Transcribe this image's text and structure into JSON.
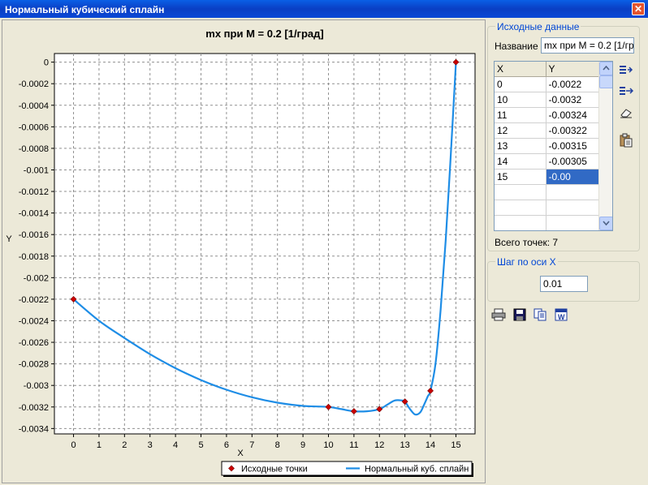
{
  "window": {
    "title": "Нормальный кубический сплайн",
    "close_glyph": "✕"
  },
  "chart_data": {
    "type": "line",
    "title": "mx при M = 0.2  [1/град]",
    "xlabel": "X",
    "ylabel": "Y",
    "xlim": [
      -0.75,
      15.75
    ],
    "ylim": [
      -0.00345,
      8e-05
    ],
    "x_ticks": [
      0,
      1,
      2,
      3,
      4,
      5,
      6,
      7,
      8,
      9,
      10,
      11,
      12,
      13,
      14,
      15
    ],
    "y_ticks": [
      0,
      -0.0002,
      -0.0004,
      -0.0006,
      -0.0008,
      -0.001,
      -0.0012,
      -0.0014,
      -0.0016,
      -0.0018,
      -0.002,
      -0.0022,
      -0.0024,
      -0.0026,
      -0.0028,
      -0.003,
      -0.0032,
      -0.0034
    ],
    "grid": true,
    "legend_position": "bottom",
    "series": [
      {
        "name": "Исходные точки",
        "kind": "markers",
        "color": "#cc0000",
        "x": [
          0,
          10,
          11,
          12,
          13,
          14,
          15
        ],
        "y": [
          -0.0022,
          -0.0032,
          -0.00324,
          -0.00322,
          -0.00315,
          -0.00305,
          0.0
        ]
      },
      {
        "name": "Нормальный куб. сплайн",
        "kind": "line",
        "color": "#1e8de6",
        "x": [
          0,
          1,
          2,
          3,
          4,
          5,
          6,
          7,
          8,
          9,
          10,
          10.5,
          11,
          11.5,
          12,
          12.3,
          12.6,
          12.9,
          13.0,
          13.2,
          13.4,
          13.6,
          13.75,
          13.9,
          14.0,
          14.2,
          14.4,
          14.6,
          14.8,
          15.0
        ],
        "y": [
          -0.0022,
          -0.0024,
          -0.00256,
          -0.00271,
          -0.00284,
          -0.00295,
          -0.00304,
          -0.00311,
          -0.00316,
          -0.00319,
          -0.0032,
          -0.00322,
          -0.00324,
          -0.00324,
          -0.00322,
          -0.00318,
          -0.00314,
          -0.00314,
          -0.00315,
          -0.00322,
          -0.00327,
          -0.00325,
          -0.00318,
          -0.0031,
          -0.00305,
          -0.0028,
          -0.0023,
          -0.00165,
          -0.00085,
          0.0
        ]
      }
    ]
  },
  "side": {
    "source_group_title": "Исходные данные",
    "name_label": "Название",
    "name_value": "mx при M = 0.2  [1/гр",
    "columns": [
      "X",
      "Y"
    ],
    "rows": [
      {
        "x": "0",
        "y": "-0.0022"
      },
      {
        "x": "10",
        "y": "-0.0032"
      },
      {
        "x": "11",
        "y": "-0.00324"
      },
      {
        "x": "12",
        "y": "-0.00322"
      },
      {
        "x": "13",
        "y": "-0.00315"
      },
      {
        "x": "14",
        "y": "-0.00305"
      },
      {
        "x": "15",
        "y": "-0.00"
      }
    ],
    "total_points_label": "Всего точек: 7",
    "step_group_title": "Шаг по оси X",
    "step_value": "0.01",
    "icons": {
      "insert_row": "insert-row-icon",
      "append_row": "append-row-icon",
      "clear": "eraser-icon",
      "paste": "paste-icon",
      "print": "print-icon",
      "save": "save-icon",
      "copy": "copy-icon",
      "export_word": "word-export-icon"
    }
  }
}
